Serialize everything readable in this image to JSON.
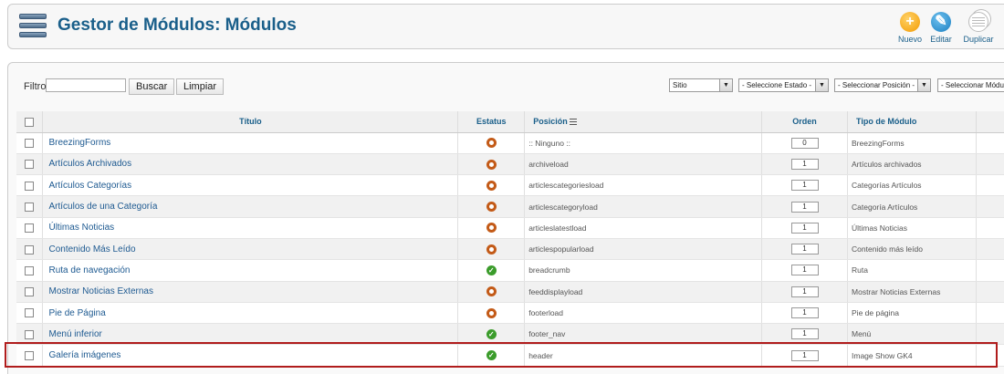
{
  "header": {
    "title": "Gestor de Módulos: Módulos",
    "toolbar": [
      {
        "label": "Nuevo",
        "icon": "add-icon"
      },
      {
        "label": "Editar",
        "icon": "edit-icon"
      },
      {
        "label": "Duplicar",
        "icon": "copy-icon"
      }
    ]
  },
  "filter": {
    "label": "Filtro:",
    "value": "",
    "search_button": "Buscar",
    "clear_button": "Limpiar",
    "selects": [
      {
        "value": "Sitio"
      },
      {
        "value": "- Seleccione Estado -"
      },
      {
        "value": "- Seleccionar Posición -"
      },
      {
        "value": "- Seleccionar Módu"
      }
    ]
  },
  "table": {
    "headers": {
      "title": "Título",
      "status": "Estatus",
      "position": "Posición",
      "order": "Orden",
      "type": "Tipo de Módulo"
    },
    "rows": [
      {
        "title": "BreezingForms",
        "status": "unpublished",
        "position": ":: Ninguno ::",
        "order": "0",
        "type": "BreezingForms"
      },
      {
        "title": "Artículos Archivados",
        "status": "unpublished",
        "position": "archiveload",
        "order": "1",
        "type": "Artículos archivados"
      },
      {
        "title": "Artículos Categorías",
        "status": "unpublished",
        "position": "articlescategoriesload",
        "order": "1",
        "type": "Categorías Artículos"
      },
      {
        "title": "Artículos de una Categoría",
        "status": "unpublished",
        "position": "articlescategoryload",
        "order": "1",
        "type": "Categoría Artículos"
      },
      {
        "title": "Últimas Noticias",
        "status": "unpublished",
        "position": "articleslatestload",
        "order": "1",
        "type": "Últimas Noticias"
      },
      {
        "title": "Contenido Más Leído",
        "status": "unpublished",
        "position": "articlespopularload",
        "order": "1",
        "type": "Contenido más leído"
      },
      {
        "title": "Ruta de navegación",
        "status": "published",
        "position": "breadcrumb",
        "order": "1",
        "type": "Ruta"
      },
      {
        "title": "Mostrar Noticias Externas",
        "status": "unpublished",
        "position": "feeddisplayload",
        "order": "1",
        "type": "Mostrar Noticias Externas"
      },
      {
        "title": "Pie de Página",
        "status": "unpublished",
        "position": "footerload",
        "order": "1",
        "type": "Pie de página"
      },
      {
        "title": "Menú inferior",
        "status": "published",
        "position": "footer_nav",
        "order": "1",
        "type": "Menú"
      },
      {
        "title": "Galería imágenes",
        "status": "published",
        "position": "header",
        "order": "1",
        "type": "Image Show GK4"
      }
    ]
  },
  "colors": {
    "title": "#1a5f8a",
    "link": "#1e5a91",
    "unpublished": "#c35a17",
    "published": "#3b9c2b",
    "highlight": "#b01c1c"
  }
}
